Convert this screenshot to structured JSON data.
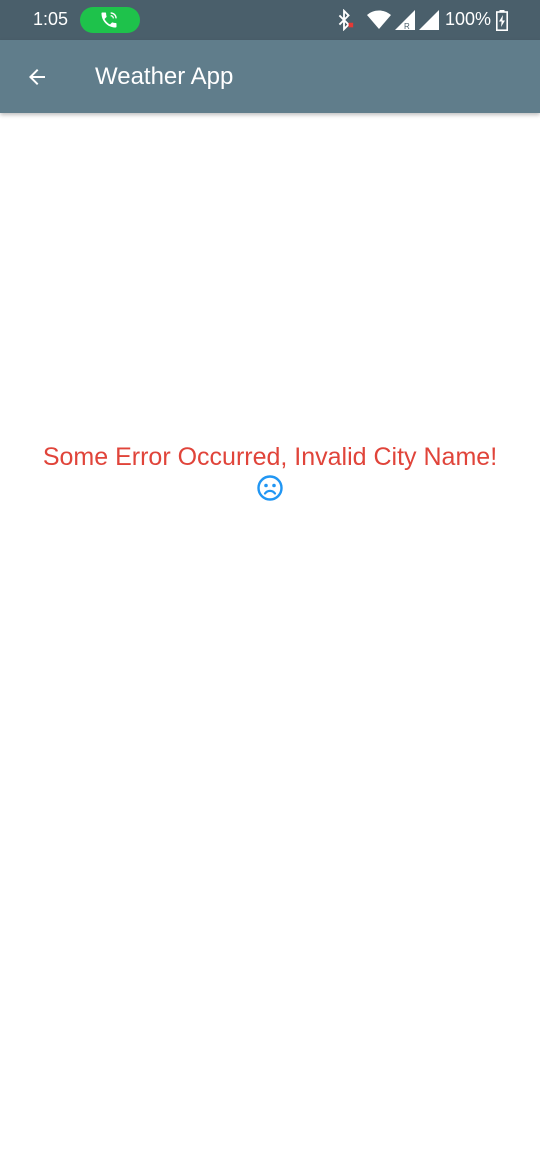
{
  "status_bar": {
    "time": "1:05",
    "battery": "100%",
    "icons": [
      "call-active-icon",
      "bluetooth-icon",
      "wifi-icon",
      "signal-roaming-icon",
      "signal-icon",
      "battery-charging-icon"
    ],
    "call_pill_color": "#1ec24b"
  },
  "app_bar": {
    "title": "Weather App",
    "back_icon": "arrow-left-icon",
    "color": "#607d8b"
  },
  "error": {
    "message": "Some Error Occurred, Invalid City Name!",
    "icon": "sad-face-icon",
    "color": "#e0443a",
    "icon_color": "#2196f3"
  }
}
